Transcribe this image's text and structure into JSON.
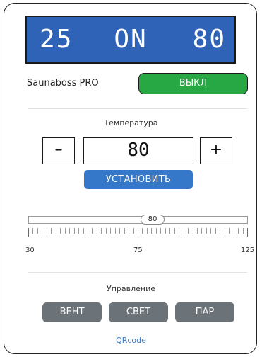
{
  "display": {
    "left_value": "25",
    "status": "ON",
    "right_value": "80"
  },
  "device": {
    "name": "Saunaboss PRO",
    "power_button_label": "ВЫКЛ"
  },
  "temperature": {
    "title": "Температура",
    "minus_label": "–",
    "value": "80",
    "plus_label": "+",
    "set_button_label": "УСТАНОВИТЬ"
  },
  "slider": {
    "value_label": "80",
    "min": "30",
    "mid": "75",
    "max": "125"
  },
  "control": {
    "title": "Управление",
    "buttons": [
      {
        "label": "ВЕНТ"
      },
      {
        "label": "СВЕТ"
      },
      {
        "label": "ПАР"
      }
    ]
  },
  "footer": {
    "qr_link_label": "QRcode"
  },
  "colors": {
    "display_bg": "#2f63b8",
    "power_on": "#28a745",
    "accent": "#3578c9",
    "ctrl_btn": "#6b7278"
  }
}
